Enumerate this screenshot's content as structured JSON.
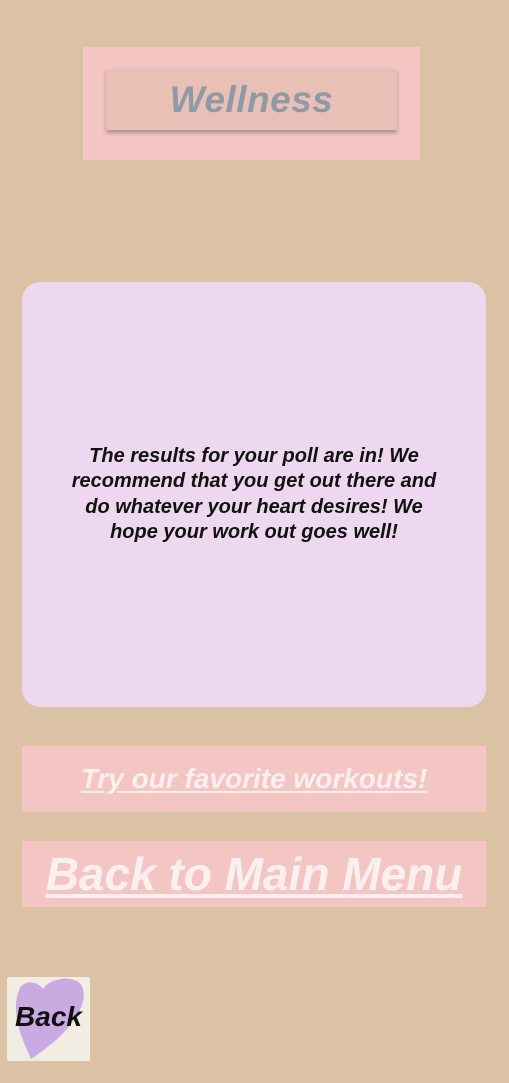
{
  "header": {
    "title": "Wellness"
  },
  "result": {
    "message": "The results for your poll are in! We recommend that you get out there and do whatever your heart desires! We hope your work out goes well!"
  },
  "links": {
    "workouts": "Try our favorite workouts!",
    "main_menu": "Back to Main Menu"
  },
  "back_button": {
    "label": "Back",
    "icon": "heart-icon"
  },
  "colors": {
    "background": "#dbc2a4",
    "pink_panel": "#f3c6c4",
    "title_plate": "#e8c0b5",
    "title_text": "#8f9aa6",
    "card": "#edd8ef",
    "link_text": "#fbf0ef",
    "heart": "#c6a6e0"
  }
}
